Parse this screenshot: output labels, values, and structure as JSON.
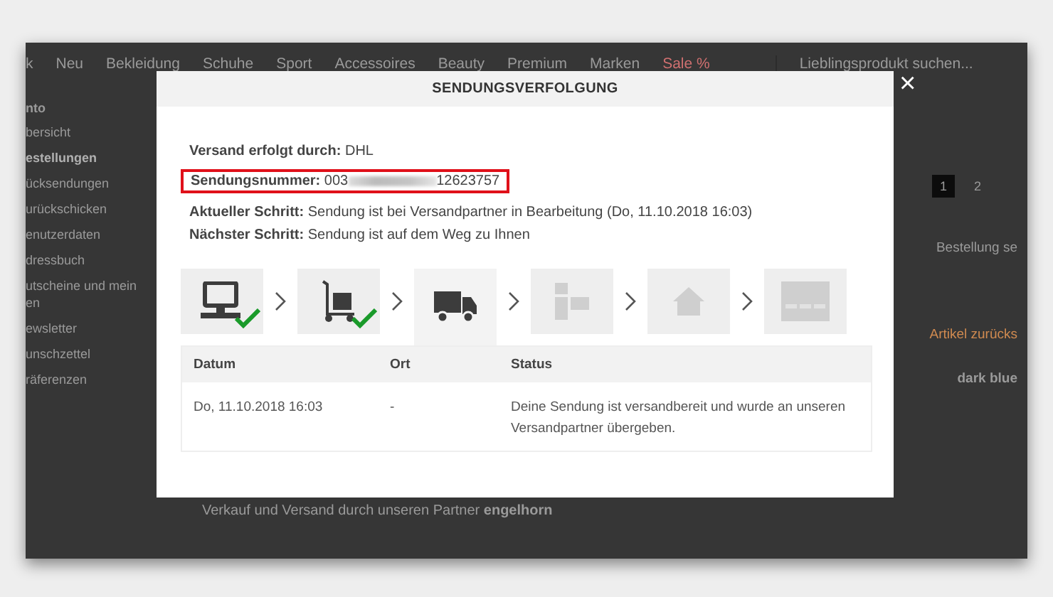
{
  "page": {
    "nav": [
      {
        "label": "k",
        "kind": "normal"
      },
      {
        "label": "Neu",
        "kind": "normal"
      },
      {
        "label": "Bekleidung",
        "kind": "normal"
      },
      {
        "label": "Schuhe",
        "kind": "normal"
      },
      {
        "label": "Sport",
        "kind": "normal"
      },
      {
        "label": "Accessoires",
        "kind": "normal"
      },
      {
        "label": "Beauty",
        "kind": "normal"
      },
      {
        "label": "Premium",
        "kind": "normal"
      },
      {
        "label": "Marken",
        "kind": "normal"
      },
      {
        "label": "Sale %",
        "kind": "sale"
      }
    ],
    "search": {
      "placeholder": "Lieblingsprodukt suchen..."
    },
    "sidebar": {
      "heading": "nto",
      "items": [
        {
          "label": "bersicht",
          "selected": false
        },
        {
          "label": "estellungen",
          "selected": true
        },
        {
          "label": "ücksendungen",
          "selected": false
        },
        {
          "label": "urückschicken",
          "selected": false
        },
        {
          "label": "enutzerdaten",
          "selected": false
        },
        {
          "label": "dressbuch",
          "selected": false
        },
        {
          "label": "utscheine und mein\nen",
          "selected": false
        },
        {
          "label": "ewsletter",
          "selected": false
        },
        {
          "label": "unschzettel",
          "selected": false
        },
        {
          "label": "räferenzen",
          "selected": false
        }
      ]
    },
    "pagination": [
      {
        "label": "1",
        "selected": true
      },
      {
        "label": "2",
        "selected": false
      }
    ],
    "order_label": "Bestellung se",
    "return_link": "Artikel zurücks",
    "color_label": "dark blue",
    "partner_note": "Verkauf und Versand durch unseren Partner **engelhorn**"
  },
  "modal": {
    "title": "SENDUNGSVERFOLGUNG",
    "close": "×",
    "carrier": {
      "label": "Versand erfolgt durch:",
      "value": "DHL"
    },
    "tracking": {
      "label": "Sendungsnummer:",
      "start": "003",
      "end": "12623757",
      "highlighted": true
    },
    "current_step": {
      "label": "Aktueller Schritt:",
      "value": "Sendung ist bei Versandpartner in Bearbeitung (Do, 11.10.2018 16:03)"
    },
    "next_step": {
      "label": "Nächster Schritt:",
      "value": "Sendung ist auf dem Weg zu Ihnen"
    },
    "steps": [
      {
        "kind": "monitor",
        "completed": true,
        "selected": false
      },
      {
        "kind": "handtruck",
        "completed": true,
        "selected": false
      },
      {
        "kind": "truck",
        "completed": false,
        "selected": true
      },
      {
        "kind": "boxes",
        "completed": false,
        "selected": false
      },
      {
        "kind": "house",
        "completed": false,
        "selected": false
      },
      {
        "kind": "warehouse",
        "completed": false,
        "selected": false
      }
    ],
    "table": {
      "columns": [
        "Datum",
        "Ort",
        "Status"
      ],
      "rows": [
        [
          "Do, 11.10.2018 16:03",
          "-",
          "Deine Sendung ist versandbereit und wurde an unseren Versandpartner übergeben."
        ]
      ]
    }
  }
}
